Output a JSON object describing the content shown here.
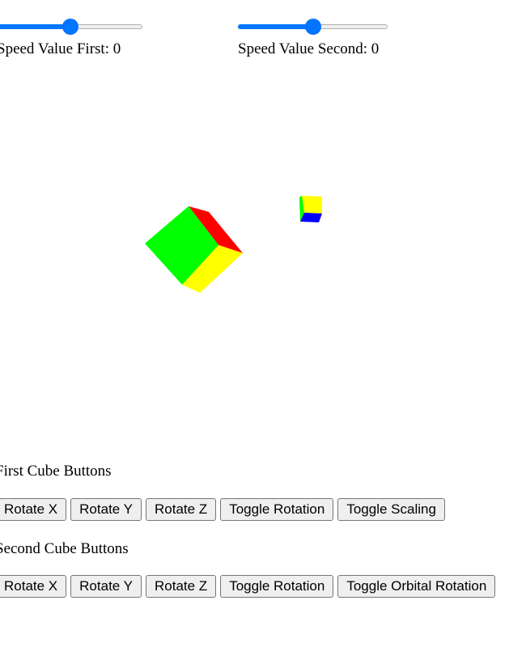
{
  "sliders": {
    "first": {
      "value_fraction": 0.52
    },
    "second": {
      "value_fraction": 0.5
    }
  },
  "speed": {
    "first_label": "Speed Value First: 0",
    "second_label": "Speed Value Second: 0"
  },
  "cube_colors": {
    "green": "#00ff00",
    "red": "#ff0000",
    "yellow": "#ffff00",
    "blue": "#0000ff"
  },
  "first_cube_section": {
    "heading": "First Cube Buttons",
    "buttons": [
      "Rotate X",
      "Rotate Y",
      "Rotate Z",
      "Toggle Rotation",
      "Toggle Scaling"
    ]
  },
  "second_cube_section": {
    "heading": "Second Cube Buttons",
    "buttons": [
      "Rotate X",
      "Rotate Y",
      "Rotate Z",
      "Toggle Rotation",
      "Toggle Orbital Rotation"
    ]
  },
  "accent_color": "#0075ff"
}
